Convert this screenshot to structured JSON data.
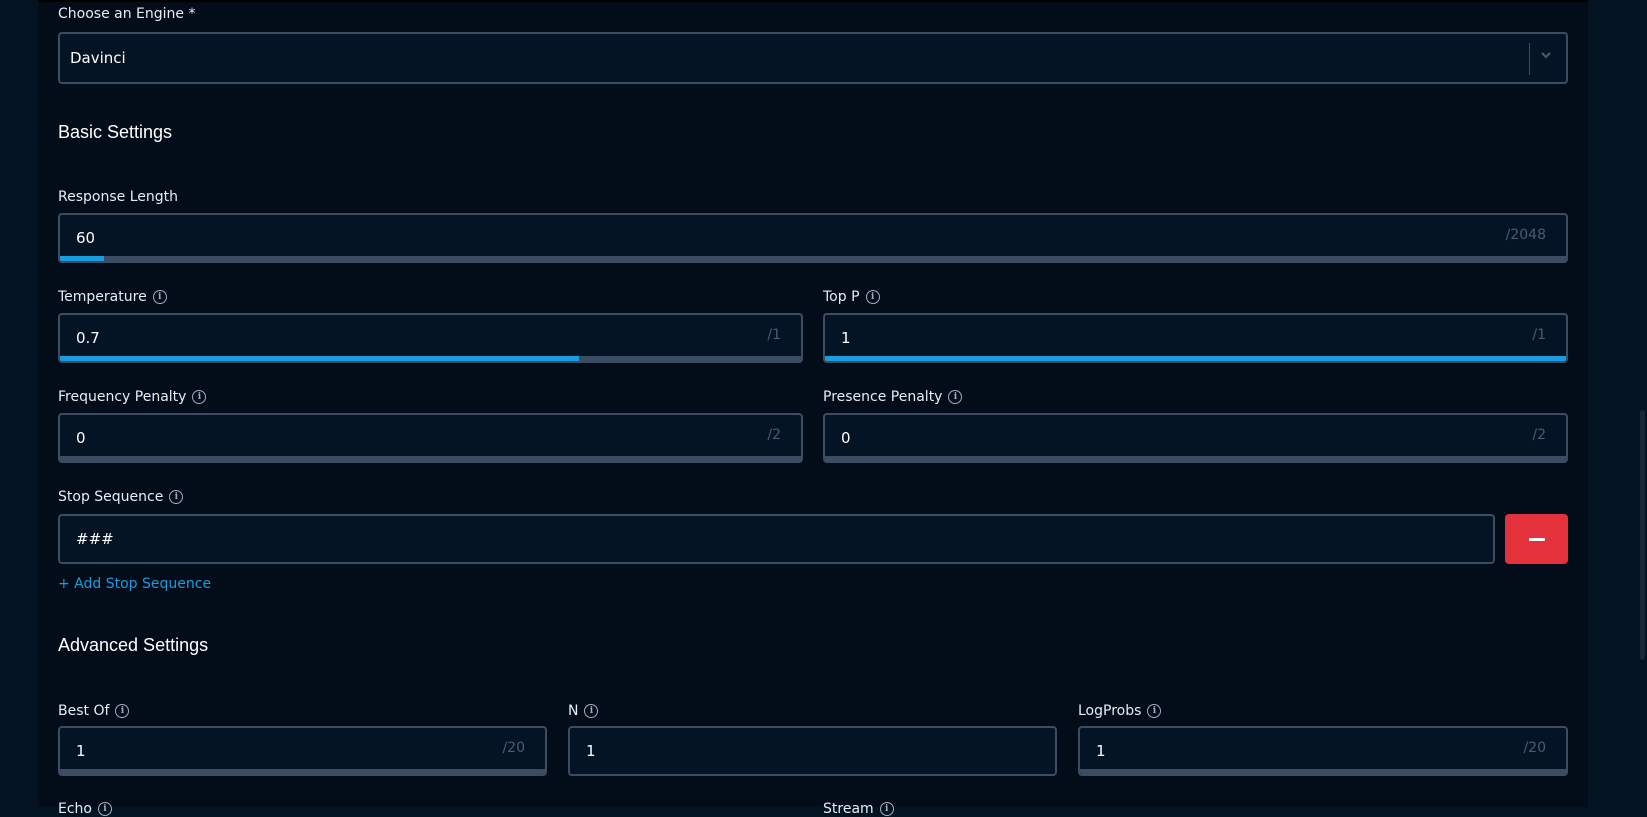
{
  "engine": {
    "label": "Choose an Engine *",
    "value": "Davinci"
  },
  "basic": {
    "heading": "Basic Settings",
    "response_length": {
      "label": "Response Length",
      "value": "60",
      "max": "/2048",
      "progress": 0.029
    },
    "temperature": {
      "label": "Temperature",
      "value": "0.7",
      "max": "/1",
      "progress": 0.7
    },
    "top_p": {
      "label": "Top P",
      "value": "1",
      "max": "/1",
      "progress": 1.0
    },
    "frequency_penalty": {
      "label": "Frequency Penalty",
      "value": "0",
      "max": "/2",
      "progress": 0
    },
    "presence_penalty": {
      "label": "Presence Penalty",
      "value": "0",
      "max": "/2",
      "progress": 0
    },
    "stop_sequence": {
      "label": "Stop Sequence",
      "value": "###",
      "add_label": "+ Add Stop Sequence"
    }
  },
  "advanced": {
    "heading": "Advanced Settings",
    "best_of": {
      "label": "Best Of",
      "value": "1",
      "max": "/20"
    },
    "n": {
      "label": "N",
      "value": "1"
    },
    "logprobs": {
      "label": "LogProbs",
      "value": "1",
      "max": "/20"
    },
    "echo": {
      "label": "Echo"
    },
    "stream": {
      "label": "Stream"
    }
  },
  "colors": {
    "accent": "#1a9ce0",
    "danger": "#e4323c",
    "background": "#020d19"
  }
}
